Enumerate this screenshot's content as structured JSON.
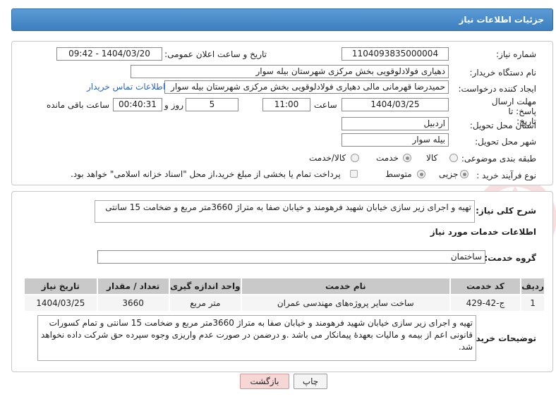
{
  "header": {
    "title": "جزئیات اطلاعات نیاز"
  },
  "form": {
    "need_number_label": "شماره نیاز:",
    "need_number": "1104093835000004",
    "announce_label": "تاریخ و ساعت اعلان عمومی:",
    "announce_value": "1404/03/20 - 09:42",
    "buyer_org_label": "نام دستگاه خریدار:",
    "buyer_org": "دهیاری فولادلوقویی بخش مرکزی شهرستان بیله سوار",
    "creator_label": "ایجاد کننده درخواست:",
    "creator": "حمیدرضا قهرمانی مالی دهیاری فولادلوقویی بخش مرکزی شهرستان بیله سوار",
    "contact_link": "اطلاعات تماس خریدار",
    "deadline_label": "مهلت ارسال پاسخ: تا تاریخ:",
    "deadline_date": "1404/03/25",
    "time_label": "ساعت",
    "deadline_time": "11:00",
    "days_value": "5",
    "days_label": "روز و",
    "remaining_time": "00:40:31",
    "remaining_label": "ساعت باقی مانده",
    "province_label": "استان محل تحویل:",
    "province": "اردبیل",
    "city_label": "شهر محل تحویل:",
    "city": "بیله سوار",
    "category_label": "طبقه بندی موضوعی:",
    "category_options": [
      "کالا",
      "خدمت",
      "کالا/خدمت"
    ],
    "category_selected": "خدمت",
    "process_label": "نوع فرآیند خرید :",
    "process_options": [
      "جزیی",
      "متوسط"
    ],
    "process_selected": "جزیی",
    "payment_note": "پرداخت تمام یا بخشی از مبلغ خرید،از محل \"اسناد خزانه اسلامی\" خواهد بود."
  },
  "details": {
    "summary_label": "شرح کلی نیاز:",
    "summary": "تهیه و اجرای زیر سازی خیابان شهید فرهومند و خیابان صفا به متراژ 3660متر مربع و ضخامت 15 سانتی",
    "services_title": "اطلاعات خدمات مورد نیاز",
    "group_label": "گروه خدمت:",
    "group_value": "ساختمان",
    "table": {
      "headers": [
        "ردیف",
        "کد خدمت",
        "نام خدمت",
        "واحد اندازه گیری",
        "تعداد / مقدار",
        "تاریخ نیاز"
      ],
      "rows": [
        [
          "1",
          "ج-42-429",
          "ساخت سایر پروژه‌های مهندسی عمران",
          "متر مربع",
          "3660",
          "1404/03/25"
        ]
      ]
    },
    "buyer_notes_label": "توضیحات خریدار:",
    "buyer_notes": "تهیه و اجرای زیر سازی خیابان شهید فرهومند و خیابان صفا به متراژ 3660متر مربع و ضخامت 15 سانتی و تمام کسورات قانونی اعم از بیمه و مالیات بعهدهٔ پیمانکار می باشد .و درضمن در صورت عدم واریزی وجوه سپرده حق شرکت داده نخواهد شد."
  },
  "buttons": {
    "print": "چاپ",
    "back": "بازگشت"
  },
  "colors": {
    "header": "#4a8cca",
    "back_button": "#f7d6d6",
    "link": "#2a62c9"
  }
}
